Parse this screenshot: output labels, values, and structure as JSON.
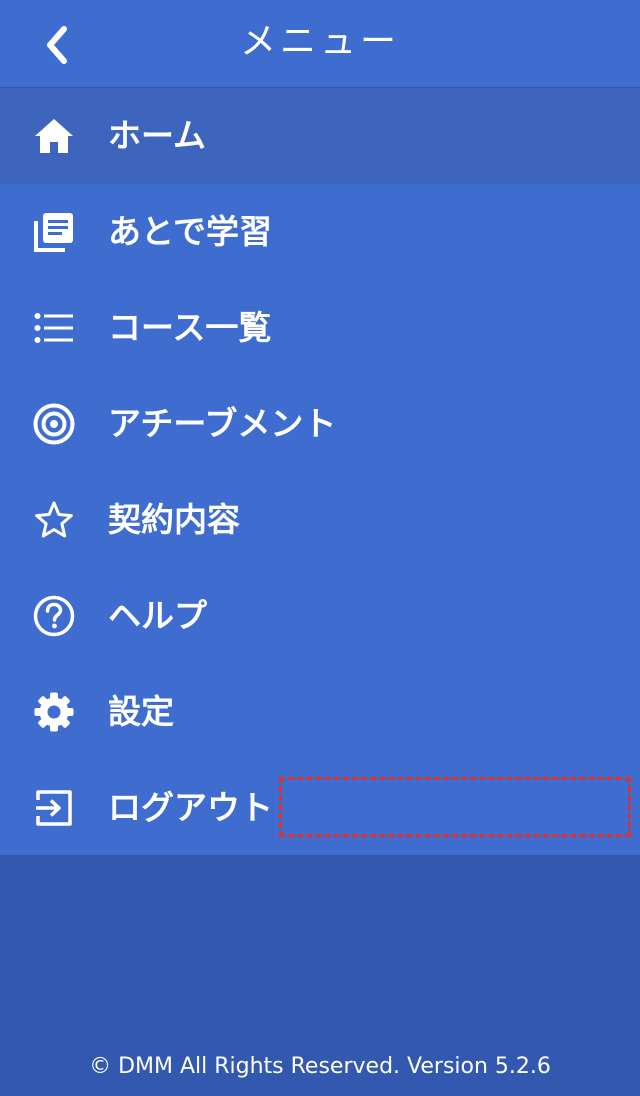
{
  "header": {
    "title": "メニュー",
    "back_icon": "chevron-left-icon"
  },
  "menu": {
    "items": [
      {
        "label": "ホーム",
        "icon": "home-icon",
        "active": true
      },
      {
        "label": "あとで学習",
        "icon": "library-icon",
        "active": false
      },
      {
        "label": "コース一覧",
        "icon": "list-icon",
        "active": false
      },
      {
        "label": "アチーブメント",
        "icon": "target-icon",
        "active": false
      },
      {
        "label": "契約内容",
        "icon": "star-icon",
        "active": false
      },
      {
        "label": "ヘルプ",
        "icon": "help-circle-icon",
        "active": false
      },
      {
        "label": "設定",
        "icon": "gear-icon",
        "active": false
      },
      {
        "label": "ログアウト",
        "icon": "logout-icon",
        "active": false
      }
    ]
  },
  "footer": {
    "text": "© DMM All Rights Reserved. Version 5.2.6"
  },
  "colors": {
    "header_bg": "#3f6dcf",
    "menu_bg": "#3f6dcf",
    "active_bg": "#3d65bd",
    "page_bg": "#3258b0",
    "highlight": "#e0322a"
  }
}
